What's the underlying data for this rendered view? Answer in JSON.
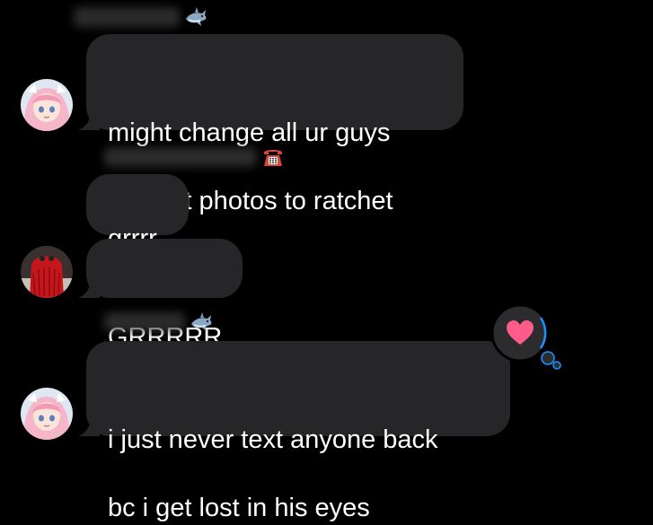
{
  "conversation": {
    "messages": [
      {
        "sender_emoji": "shark-emoji",
        "avatar": "anime-girl-avatar",
        "lines": [
          "might change all ur guys",
          "contact photos to ratchet"
        ]
      },
      {
        "sender_emoji": "telephone-emoji",
        "text_1": "grrrr",
        "text_2": "GRRRRR",
        "avatar": "red-furry-avatar"
      },
      {
        "sender_emoji": "shark-emoji",
        "avatar": "anime-girl-avatar",
        "tapback": "heart-icon",
        "lines": [
          "i just never text anyone back",
          "bc i get lost in his eyes"
        ]
      }
    ]
  },
  "colors": {
    "background": "#000000",
    "bubble": "#262628",
    "tapback_bubble": "#2c2c2e",
    "tapback_border": "#1e90ff",
    "heart": "#ff5c8a"
  }
}
